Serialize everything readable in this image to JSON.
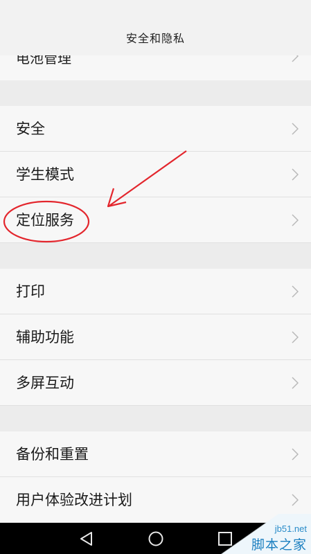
{
  "header": {
    "title": "安全和隐私"
  },
  "partial_row": {
    "label": "电池管理"
  },
  "groups": [
    {
      "items": [
        {
          "label": "安全"
        },
        {
          "label": "学生模式"
        },
        {
          "label": "定位服务"
        }
      ]
    },
    {
      "items": [
        {
          "label": "打印"
        },
        {
          "label": "辅助功能"
        },
        {
          "label": "多屏互动"
        }
      ]
    },
    {
      "items": [
        {
          "label": "备份和重置"
        },
        {
          "label": "用户体验改进计划"
        }
      ]
    }
  ],
  "annotation": {
    "highlighted_item": "定位服务",
    "color": "#e3262d"
  },
  "navbar": {
    "buttons": [
      "back-icon",
      "home-icon",
      "recents-icon"
    ]
  },
  "watermark": {
    "site": "jb51.net",
    "name": "脚本之家"
  }
}
